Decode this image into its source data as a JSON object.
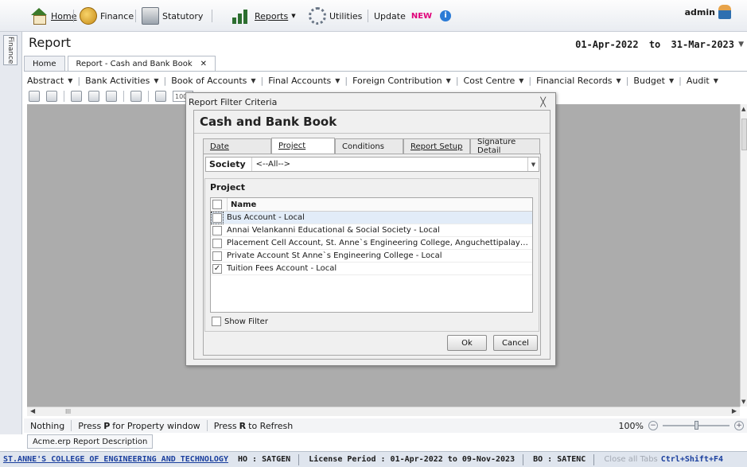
{
  "menu": {
    "home": "Home",
    "finance": "Finance",
    "statutory": "Statutory",
    "reports": "Reports",
    "utilities": "Utilities",
    "update": "Update",
    "new_badge": "NEW",
    "info": "i",
    "user": "admin"
  },
  "sidebar": {
    "tab": "Finance"
  },
  "page": {
    "title": "Report",
    "period_from": "01-Apr-2022",
    "period_to_word": "to",
    "period_to": "31-Mar-2023"
  },
  "doc_tabs": [
    {
      "label": "Home"
    },
    {
      "label": "Report - Cash and Bank Book"
    }
  ],
  "report_menu": [
    "Abstract",
    "Bank Activities",
    "Book of Accounts",
    "Final Accounts",
    "Foreign Contribution",
    "Cost Centre",
    "Financial Records",
    "Budget",
    "Audit"
  ],
  "toolbar": {
    "zoom": "100%"
  },
  "dialog": {
    "title": "Report Filter Criteria",
    "close_glyph": "╳",
    "heading": "Cash and Bank Book",
    "tabs": [
      "Date",
      "Project",
      "Conditions",
      "Report Setup",
      "Signature Detail"
    ],
    "active_tab": "Project",
    "society_label": "Society",
    "society_value": "<--All-->",
    "project_group_label": "Project",
    "grid_header": "Name",
    "projects": [
      {
        "name": "Bus Account - Local",
        "checked": false
      },
      {
        "name": "Annai Velankanni Educational & Social Society - Local",
        "checked": false
      },
      {
        "name": "Placement Cell Account, St. Anne`s Engineering College, Anguchettipalayam, Panr...",
        "checked": false
      },
      {
        "name": "Private Account St Anne`s Engineering  College - Local",
        "checked": false
      },
      {
        "name": "Tuition  Fees Account - Local",
        "checked": true
      }
    ],
    "show_filter": "Show Filter",
    "ok": "Ok",
    "cancel": "Cancel"
  },
  "status": {
    "nothing": "Nothing",
    "press1": "Press",
    "key_p": "P",
    "hint1": "for Property window",
    "press2": "Press",
    "key_r": "R",
    "hint2": "to Refresh",
    "zoom": "100%"
  },
  "description_tab": "Acme.erp Report Description",
  "footer": {
    "college": "ST.ANNE'S COLLEGE OF ENGINEERING AND TECHNOLOGY",
    "ho": "HO : SATGEN",
    "license": "License Period :  01-Apr-2022 to 09-Nov-2023",
    "bo": "BO : SATENC",
    "close_all": "Close all Tabs",
    "shortcut": "Ctrl+Shift+F4"
  },
  "colors": {
    "new_badge": "#e0007a",
    "footer_link": "#1a3f9e",
    "workarea": "#acacac"
  }
}
